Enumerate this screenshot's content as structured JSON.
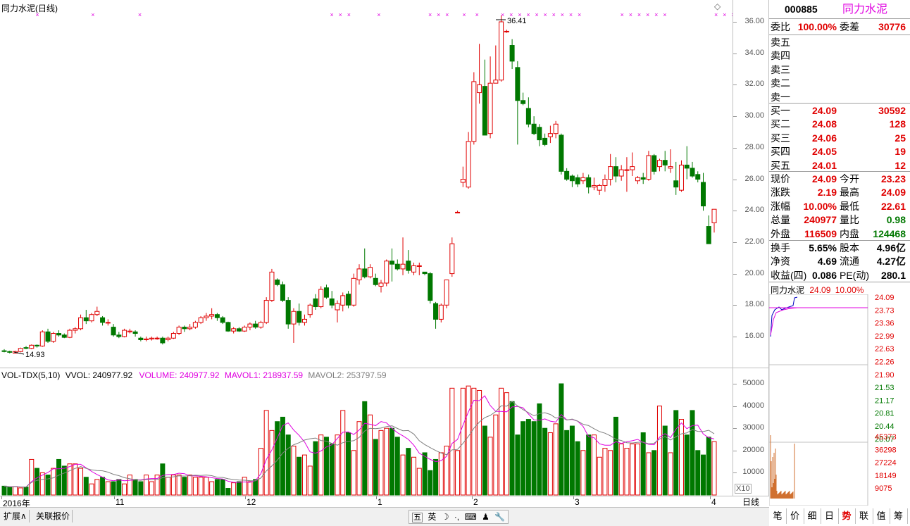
{
  "chart": {
    "title": "同力水泥(日线)",
    "diamond_icon": "diamond-icon",
    "high_marker": "36.41",
    "low_marker": "14.93",
    "price_ticks": [
      "36.00",
      "34.00",
      "32.00",
      "30.00",
      "28.00",
      "26.00",
      "24.00",
      "22.00",
      "20.00",
      "18.00",
      "16.00"
    ],
    "x_marks": "×"
  },
  "volume": {
    "label": "VOL-TDX(5,10)",
    "vvol": "VVOL: 240977.92",
    "volume": "VOLUME: 240977.92",
    "mavol1": "MAVOL1: 218937.59",
    "mavol2": "MAVOL2: 253797.59",
    "ticks": [
      "50000",
      "40000",
      "30000",
      "20000",
      "10000"
    ],
    "x10": "X10"
  },
  "dates": {
    "labels": [
      "2016年",
      "11",
      "12",
      "1",
      "2",
      "3",
      "4"
    ]
  },
  "period_tab": "日线",
  "bottom": {
    "expand": "扩展∧",
    "related": "关联报价",
    "ime": [
      "五",
      "英",
      "☽",
      "·,",
      "⌨",
      "♟",
      "🔧"
    ]
  },
  "side": {
    "code": "000885",
    "name": "同力水泥",
    "weibi_label": "委比",
    "weibi": "100.00%",
    "weicha_label": "委差",
    "weicha": "30776",
    "sell": [
      {
        "label": "卖五",
        "price": "",
        "vol": ""
      },
      {
        "label": "卖四",
        "price": "",
        "vol": ""
      },
      {
        "label": "卖三",
        "price": "",
        "vol": ""
      },
      {
        "label": "卖二",
        "price": "",
        "vol": ""
      },
      {
        "label": "卖一",
        "price": "",
        "vol": ""
      }
    ],
    "buy": [
      {
        "label": "买一",
        "price": "24.09",
        "vol": "30592"
      },
      {
        "label": "买二",
        "price": "24.08",
        "vol": "128"
      },
      {
        "label": "买三",
        "price": "24.06",
        "vol": "25"
      },
      {
        "label": "买四",
        "price": "24.05",
        "vol": "19"
      },
      {
        "label": "买五",
        "price": "24.01",
        "vol": "12"
      }
    ],
    "quote": [
      {
        "l1": "现价",
        "v1": "24.09",
        "c1": "red",
        "l2": "今开",
        "v2": "23.23",
        "c2": "red"
      },
      {
        "l1": "涨跌",
        "v1": "2.19",
        "c1": "red",
        "l2": "最高",
        "v2": "24.09",
        "c2": "red"
      },
      {
        "l1": "涨幅",
        "v1": "10.00%",
        "c1": "red",
        "l2": "最低",
        "v2": "22.61",
        "c2": "red"
      },
      {
        "l1": "总量",
        "v1": "240977",
        "c1": "red",
        "l2": "量比",
        "v2": "0.98",
        "c2": "green"
      },
      {
        "l1": "外盘",
        "v1": "116509",
        "c1": "red",
        "l2": "内盘",
        "v2": "124468",
        "c2": "green"
      }
    ],
    "fund": [
      {
        "l1": "换手",
        "v1": "5.65%",
        "l2": "股本",
        "v2": "4.96亿"
      },
      {
        "l1": "净资",
        "v1": "4.69",
        "l2": "流通",
        "v2": "4.27亿"
      },
      {
        "l1": "收益(四)",
        "v1": "0.086",
        "l2": "PE(动)",
        "v2": "280.1"
      }
    ],
    "mini_title": "同力水泥",
    "mini_price": "24.09",
    "mini_pct": "10.00%",
    "mini_ticks": [
      "24.09",
      "23.73",
      "23.36",
      "22.99",
      "22.63",
      "22.26",
      "21.90",
      "21.53",
      "21.17",
      "20.81",
      "20.44",
      "20.07"
    ],
    "mini_vol_ticks": [
      "45373",
      "36298",
      "27224",
      "18149",
      "9075"
    ],
    "tabs": [
      "笔",
      "价",
      "细",
      "日",
      "势",
      "联",
      "值",
      "筹"
    ]
  },
  "colors": {
    "up": "#e00000",
    "down": "#007800",
    "ma1": "#e000e0",
    "ma2": "#808080"
  },
  "chart_data": {
    "type": "candlestick",
    "ohlc": [
      [
        15.1,
        15.2,
        15.0,
        15.05
      ],
      [
        15.05,
        15.1,
        14.93,
        15.0
      ],
      [
        14.95,
        15.1,
        14.93,
        15.05
      ],
      [
        15.05,
        15.3,
        15.0,
        15.25
      ],
      [
        15.3,
        15.4,
        15.2,
        15.25
      ],
      [
        15.25,
        15.5,
        15.2,
        15.45
      ],
      [
        15.45,
        15.5,
        15.3,
        15.4
      ],
      [
        15.4,
        16.4,
        15.35,
        16.3
      ],
      [
        16.3,
        16.5,
        15.6,
        15.7
      ],
      [
        15.7,
        16.3,
        15.6,
        16.2
      ],
      [
        16.2,
        16.4,
        16.0,
        16.1
      ],
      [
        16.1,
        16.2,
        15.9,
        15.95
      ],
      [
        15.95,
        16.5,
        15.9,
        16.4
      ],
      [
        16.4,
        16.6,
        16.2,
        16.5
      ],
      [
        16.5,
        17.4,
        16.4,
        17.2
      ],
      [
        17.2,
        17.7,
        16.8,
        17.0
      ],
      [
        17.0,
        17.5,
        16.9,
        17.4
      ],
      [
        17.4,
        17.9,
        17.3,
        17.6
      ],
      [
        17.2,
        17.3,
        16.7,
        16.9
      ],
      [
        16.9,
        17.1,
        16.7,
        16.9
      ],
      [
        16.6,
        16.8,
        16.0,
        16.1
      ],
      [
        16.1,
        16.3,
        15.9,
        16.0
      ],
      [
        16.0,
        16.5,
        15.95,
        16.4
      ],
      [
        16.3,
        16.5,
        16.2,
        16.35
      ],
      [
        16.3,
        16.4,
        16.0,
        16.2
      ],
      [
        15.9,
        16.0,
        15.7,
        15.8
      ],
      [
        15.8,
        16.0,
        15.7,
        15.85
      ],
      [
        15.85,
        16.0,
        15.75,
        15.9
      ],
      [
        15.9,
        16.0,
        15.8,
        15.9
      ],
      [
        15.9,
        16.0,
        15.5,
        15.6
      ],
      [
        15.8,
        16.0,
        15.7,
        15.9
      ],
      [
        15.9,
        16.3,
        15.85,
        16.2
      ],
      [
        16.2,
        16.7,
        16.1,
        16.6
      ],
      [
        16.6,
        16.7,
        16.3,
        16.5
      ],
      [
        16.5,
        16.8,
        16.4,
        16.6
      ],
      [
        16.6,
        17.0,
        16.5,
        16.9
      ],
      [
        16.9,
        17.3,
        16.8,
        17.2
      ],
      [
        17.2,
        17.5,
        17.0,
        17.3
      ],
      [
        17.3,
        17.8,
        17.1,
        17.4
      ],
      [
        17.4,
        17.5,
        17.0,
        17.2
      ],
      [
        17.2,
        17.3,
        16.8,
        16.9
      ],
      [
        16.9,
        16.95,
        16.3,
        16.35
      ],
      [
        16.35,
        16.6,
        16.2,
        16.5
      ],
      [
        16.5,
        16.6,
        16.3,
        16.35
      ],
      [
        16.35,
        16.7,
        16.3,
        16.6
      ],
      [
        16.6,
        16.9,
        16.4,
        16.8
      ],
      [
        16.8,
        17.0,
        16.5,
        16.6
      ],
      [
        16.6,
        17.0,
        16.5,
        16.9
      ],
      [
        16.9,
        18.5,
        16.8,
        18.3
      ],
      [
        18.3,
        20.3,
        18.2,
        20.1
      ],
      [
        19.6,
        19.7,
        19.2,
        19.3
      ],
      [
        19.3,
        19.5,
        18.2,
        18.3
      ],
      [
        18.3,
        18.5,
        16.5,
        16.8
      ],
      [
        16.8,
        17.8,
        15.6,
        17.6
      ],
      [
        17.6,
        18.1,
        16.7,
        16.9
      ],
      [
        16.9,
        17.4,
        16.7,
        17.1
      ],
      [
        17.4,
        18.1,
        17.2,
        18.0
      ],
      [
        18.4,
        18.7,
        17.7,
        17.9
      ],
      [
        17.9,
        19.2,
        17.8,
        19.0
      ],
      [
        19.1,
        19.3,
        18.4,
        18.5
      ],
      [
        18.4,
        18.9,
        17.8,
        18.0
      ],
      [
        17.7,
        18.3,
        16.9,
        18.1
      ],
      [
        18.0,
        18.8,
        17.6,
        18.6
      ],
      [
        18.7,
        18.9,
        17.8,
        18.0
      ],
      [
        18.0,
        20.0,
        17.9,
        19.7
      ],
      [
        19.6,
        20.6,
        19.3,
        20.3
      ],
      [
        20.3,
        21.6,
        19.7,
        19.8
      ],
      [
        19.8,
        20.6,
        19.7,
        20.4
      ],
      [
        19.7,
        20.0,
        19.2,
        19.3
      ],
      [
        19.2,
        19.6,
        18.8,
        19.4
      ],
      [
        19.4,
        20.9,
        19.2,
        20.8
      ],
      [
        20.8,
        21.6,
        19.5,
        20.6
      ],
      [
        20.6,
        20.9,
        20.2,
        20.3
      ],
      [
        20.3,
        22.3,
        19.9,
        20.6
      ],
      [
        20.8,
        21.5,
        20.0,
        20.2
      ],
      [
        20.1,
        20.7,
        19.9,
        20.5
      ],
      [
        20.5,
        20.7,
        19.9,
        20.5
      ],
      [
        20.1,
        20.1,
        19.9,
        20.0
      ],
      [
        20.0,
        20.1,
        18.1,
        18.3
      ],
      [
        18.1,
        18.2,
        16.5,
        17.1
      ],
      [
        17.1,
        18.1,
        16.9,
        18.0
      ],
      [
        18.0,
        19.6,
        17.8,
        19.6
      ],
      [
        20.0,
        22.3,
        19.8,
        21.9
      ],
      [
        23.9,
        24.0,
        23.85,
        23.9
      ],
      [
        25.8,
        26.8,
        25.5,
        26.0
      ],
      [
        25.5,
        29.0,
        25.4,
        28.4
      ],
      [
        28.4,
        32.8,
        28.2,
        32.2
      ],
      [
        31.5,
        34.6,
        30.8,
        32.0
      ],
      [
        31.9,
        33.6,
        29.0,
        28.8
      ],
      [
        28.9,
        33.8,
        28.6,
        32.1
      ],
      [
        32.1,
        34.5,
        32.1,
        32.3
      ],
      [
        32.3,
        36.41,
        32.2,
        36.0
      ],
      [
        35.4,
        35.5,
        35.3,
        35.4
      ],
      [
        34.5,
        34.9,
        33.0,
        33.5
      ],
      [
        33.1,
        33.5,
        28.2,
        31.0
      ],
      [
        31.0,
        31.5,
        30.7,
        30.8
      ],
      [
        30.5,
        31.2,
        29.3,
        29.5
      ],
      [
        29.5,
        30.0,
        28.8,
        28.9
      ],
      [
        29.3,
        29.5,
        28.1,
        28.5
      ],
      [
        28.6,
        28.9,
        28.1,
        28.2
      ],
      [
        28.7,
        29.4,
        28.3,
        28.9
      ],
      [
        28.9,
        29.7,
        28.6,
        29.5
      ],
      [
        28.8,
        28.9,
        26.3,
        26.5
      ],
      [
        26.5,
        26.7,
        25.9,
        26.0
      ],
      [
        26.2,
        26.3,
        25.5,
        25.9
      ],
      [
        26.1,
        26.3,
        25.5,
        25.7
      ],
      [
        25.9,
        26.4,
        25.7,
        26.1
      ],
      [
        26.1,
        26.3,
        25.1,
        25.5
      ],
      [
        25.5,
        26.1,
        25.3,
        25.6
      ],
      [
        25.3,
        25.7,
        25.0,
        25.6
      ],
      [
        25.6,
        26.3,
        25.2,
        26.0
      ],
      [
        26.0,
        27.6,
        25.6,
        26.8
      ],
      [
        26.8,
        27.4,
        25.8,
        26.2
      ],
      [
        26.2,
        26.9,
        25.9,
        26.6
      ],
      [
        26.6,
        27.4,
        25.2,
        26.6
      ],
      [
        26.6,
        27.7,
        26.2,
        26.8
      ],
      [
        25.9,
        26.2,
        25.7,
        26.1
      ],
      [
        26.1,
        26.4,
        25.7,
        26.0
      ],
      [
        26.0,
        27.8,
        25.9,
        27.5
      ],
      [
        27.5,
        27.6,
        26.3,
        26.5
      ],
      [
        26.8,
        27.3,
        26.5,
        27.2
      ],
      [
        27.2,
        27.8,
        26.5,
        26.9
      ],
      [
        26.7,
        27.9,
        26.4,
        26.8
      ],
      [
        25.9,
        27.1,
        25.0,
        25.5
      ],
      [
        25.3,
        27.2,
        25.2,
        26.9
      ],
      [
        26.9,
        28.1,
        26.0,
        26.7
      ],
      [
        26.7,
        27.1,
        26.1,
        26.2
      ],
      [
        26.3,
        26.5,
        25.8,
        26.0
      ],
      [
        25.8,
        26.4,
        24.0,
        24.3
      ],
      [
        23.0,
        23.7,
        22.0,
        21.9
      ],
      [
        23.23,
        24.09,
        22.61,
        24.09
      ]
    ],
    "volume": [
      4000,
      3500,
      3800,
      3200,
      3600,
      16000,
      12000,
      10000,
      9000,
      12000,
      16000,
      13000,
      14000,
      14000,
      12000,
      8000,
      5000,
      7000,
      8000,
      6000,
      6000,
      7000,
      5000,
      9000,
      7000,
      6000,
      9000,
      6000,
      9000,
      14000,
      8000,
      9000,
      9000,
      8000,
      9000,
      8000,
      8000,
      8000,
      6000,
      7000,
      7000,
      3000,
      5500,
      6000,
      8000,
      6000,
      7000,
      21000,
      38000,
      29000,
      33000,
      35000,
      27000,
      22000,
      17000,
      18000,
      13000,
      24000,
      27000,
      26000,
      23000,
      27000,
      38000,
      28000,
      20000,
      33000,
      42000,
      36000,
      25000,
      29000,
      30000,
      30000,
      26000,
      18000,
      21000,
      17000,
      12000,
      19000,
      11000,
      16000,
      19000,
      22000,
      48000,
      20000,
      48000,
      49000,
      48000,
      47000,
      31000,
      26000,
      36000,
      48000,
      46000,
      42000,
      27000,
      33000,
      34000,
      33000,
      41000,
      30000,
      28000,
      32000,
      50000,
      29000,
      31000,
      24000,
      20000,
      27000,
      27000,
      17000,
      21000,
      20000,
      35000,
      23000,
      21000,
      23000,
      23000,
      28000,
      19000,
      20000,
      40000,
      31000,
      19000,
      38000,
      34000,
      27000,
      38000,
      20000,
      18000,
      26000,
      24000
    ]
  }
}
